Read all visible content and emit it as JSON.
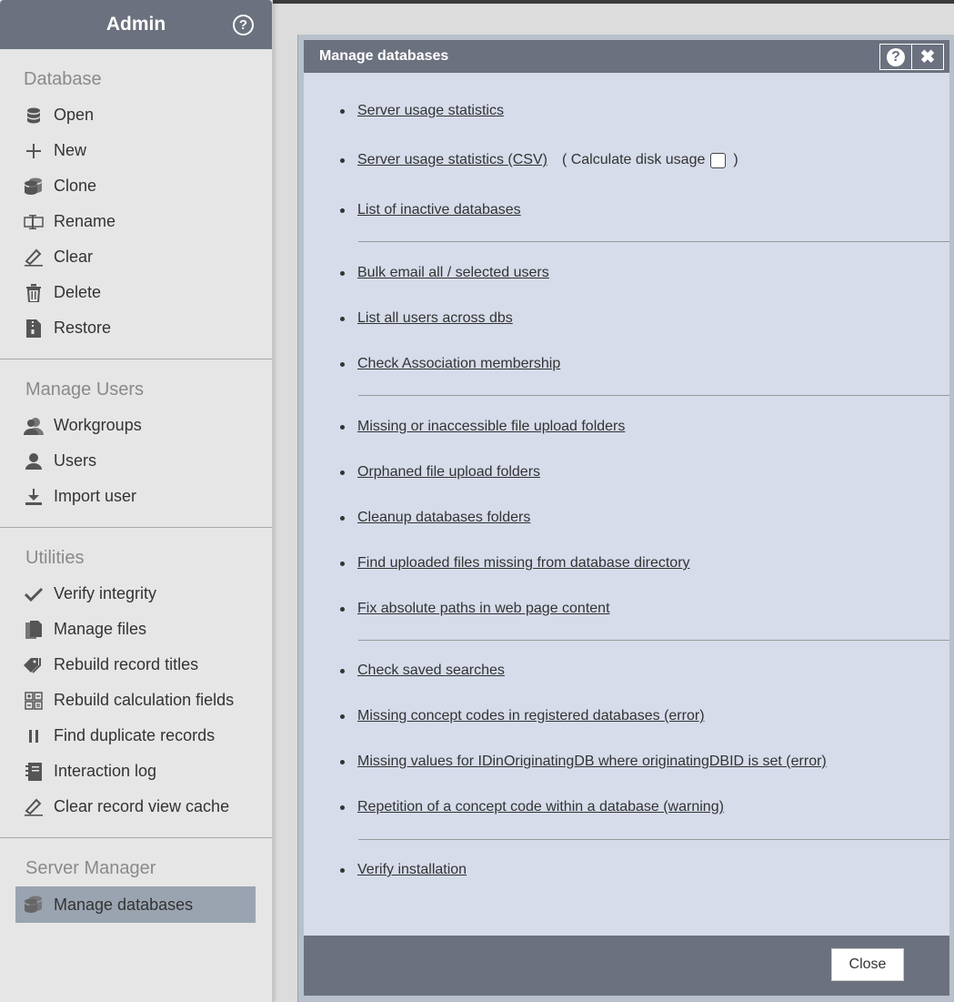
{
  "sidebar": {
    "title": "Admin",
    "sections": [
      {
        "title": "Database",
        "items": [
          {
            "label": "Open",
            "icon": "database-icon"
          },
          {
            "label": "New",
            "icon": "plus-icon"
          },
          {
            "label": "Clone",
            "icon": "clone-database-icon"
          },
          {
            "label": "Rename",
            "icon": "rename-icon"
          },
          {
            "label": "Clear",
            "icon": "eraser-icon"
          },
          {
            "label": "Delete",
            "icon": "trash-icon"
          },
          {
            "label": "Restore",
            "icon": "archive-file-icon"
          }
        ]
      },
      {
        "title": "Manage Users",
        "items": [
          {
            "label": "Workgroups",
            "icon": "workgroup-icon"
          },
          {
            "label": "Users",
            "icon": "user-icon"
          },
          {
            "label": "Import user",
            "icon": "import-icon"
          }
        ]
      },
      {
        "title": "Utilities",
        "items": [
          {
            "label": "Verify integrity",
            "icon": "checkmark-icon"
          },
          {
            "label": "Manage files",
            "icon": "files-icon"
          },
          {
            "label": "Rebuild record titles",
            "icon": "tags-icon"
          },
          {
            "label": "Rebuild calculation fields",
            "icon": "calculator-icon"
          },
          {
            "label": "Find duplicate records",
            "icon": "pause-icon"
          },
          {
            "label": "Interaction log",
            "icon": "log-book-icon"
          },
          {
            "label": "Clear record view cache",
            "icon": "eraser-icon"
          }
        ]
      },
      {
        "title": "Server Manager",
        "items": [
          {
            "label": "Manage databases",
            "icon": "database-icon",
            "active": true
          }
        ]
      }
    ]
  },
  "dialog": {
    "title": "Manage databases",
    "help_label": "?",
    "close_x": "✖",
    "links": {
      "server_stats": "Server usage statistics",
      "server_stats_csv": "Server usage statistics (CSV) ",
      "disk_usage_open": "( Calculate disk usage",
      "disk_usage_close": ")",
      "inactive": "List of inactive databases",
      "bulk_email": "Bulk email all / selected users",
      "list_users": "List all users across dbs",
      "assoc": "Check Association membership",
      "missing_folders": "Missing or inaccessible file upload folders",
      "orphaned": "Orphaned file upload folders",
      "cleanup": "Cleanup databases folders",
      "find_uploaded": "Find uploaded files missing from database directory",
      "fix_paths": "Fix absolute paths in web page content",
      "saved_searches": "Check saved searches",
      "concept_codes": "Missing concept codes in registered databases (error)",
      "idin": "Missing values for IDinOriginatingDB where originatingDBID is set (error)",
      "repetition": "Repetition of a concept code within a database (warning)",
      "verify_install": "Verify installation"
    },
    "close_button": "Close"
  }
}
